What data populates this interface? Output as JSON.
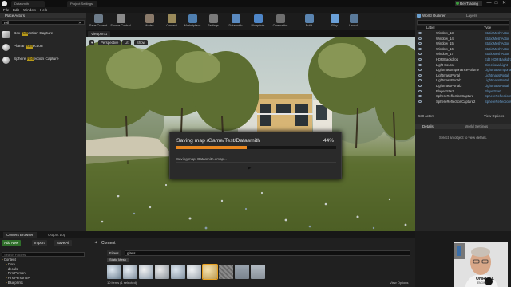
{
  "titlebar": {
    "tabs": [
      "Datasmith",
      "Project Settings"
    ],
    "project_badge": "ReyTracing",
    "window_controls": [
      "—",
      "□",
      "✕"
    ]
  },
  "menubar": {
    "items": [
      "File",
      "Edit",
      "Window",
      "Help"
    ]
  },
  "place_actors": {
    "tab_label": "Place Actors",
    "search_value": "refl",
    "items": [
      {
        "pre": "Box ",
        "hl": "Refl",
        "post": "ection Capture"
      },
      {
        "pre": "Planar ",
        "hl": "Refl",
        "post": "ection"
      },
      {
        "pre": "Sphere ",
        "hl": "Refl",
        "post": "ection Capture"
      }
    ]
  },
  "toolbar": {
    "buttons": [
      {
        "label": "Save Current",
        "color": "#6d7c8a"
      },
      {
        "label": "Source Control",
        "color": "#8a8a8a"
      },
      {
        "label": "Modes",
        "color": "#8a7a6a"
      },
      {
        "label": "Content",
        "color": "#9a8a5a"
      },
      {
        "label": "Marketplace",
        "color": "#4f7fb0"
      },
      {
        "label": "Settings",
        "color": "#7a7a7a"
      },
      {
        "label": "Datasmith",
        "color": "#5a8ac0"
      },
      {
        "label": "Blueprints",
        "color": "#4e86c8"
      },
      {
        "label": "Cinematics",
        "color": "#6e6e6e"
      },
      {
        "label": "Build",
        "color": "#5a84b0"
      },
      {
        "label": "Play",
        "color": "#6aa0d8"
      },
      {
        "label": "Launch",
        "color": "#5a7a9a"
      }
    ]
  },
  "viewport": {
    "tab_label": "Viewport 1",
    "buttons": [
      "Perspective",
      "Lit",
      "Show"
    ]
  },
  "dialog": {
    "title": "Saving map /Game/Test/Datasmith",
    "percent": "44%",
    "progress": 0.44,
    "subtask": "Saving map: Datasmith.umap..."
  },
  "world_outliner": {
    "tabs": [
      "World Outliner",
      "Layers"
    ],
    "col_label": "Label",
    "col_type": "Type",
    "rows": [
      {
        "name": "Window_13",
        "type": "StaticMeshActor"
      },
      {
        "name": "Window_14",
        "type": "StaticMeshActor"
      },
      {
        "name": "Window_15",
        "type": "StaticMeshActor"
      },
      {
        "name": "Window_16",
        "type": "StaticMeshActor"
      },
      {
        "name": "Window_17",
        "type": "StaticMeshActor"
      },
      {
        "name": "HDRIBackdrop",
        "type": "Edit HDRIBackdrop"
      },
      {
        "name": "Light Source",
        "type": "DirectionalLight"
      },
      {
        "name": "LightmassImportanceVolume",
        "type": "LightmassImportance"
      },
      {
        "name": "LightmassPortal",
        "type": "LightmassPortal"
      },
      {
        "name": "LightmassPortal2",
        "type": "LightmassPortal"
      },
      {
        "name": "LightmassPortal3",
        "type": "LightmassPortal"
      },
      {
        "name": "Player Start",
        "type": "PlayerStart"
      },
      {
        "name": "SphereReflectionCapture",
        "type": "SphereReflectionCapture"
      },
      {
        "name": "SphereReflectionCapture2",
        "type": "SphereReflectionCapture"
      }
    ],
    "actor_count": "538 actors",
    "view_options": "View Options"
  },
  "details": {
    "tabs": [
      "Details",
      "World Settings"
    ],
    "empty_message": "Select an object to view details."
  },
  "content_browser": {
    "tabs": [
      "Content Browser",
      "Output Log"
    ],
    "add_new": "Add New",
    "import": "Import",
    "save_all": "Save All",
    "path": "Content",
    "filters": "Filters",
    "search_value": "glass",
    "filter_chip": "Static Mesh",
    "folders": [
      "Content",
      "Core",
      "decals",
      "FirstPerson",
      "FirstPersonBP",
      "Blueprints"
    ],
    "search_folders_placeholder": "Search Folders",
    "status": "10 items (1 selected)",
    "view_options": "View Options"
  },
  "webcam_overlay": {
    "brand": "UNREAL",
    "brand_sub": "ENGINE"
  }
}
